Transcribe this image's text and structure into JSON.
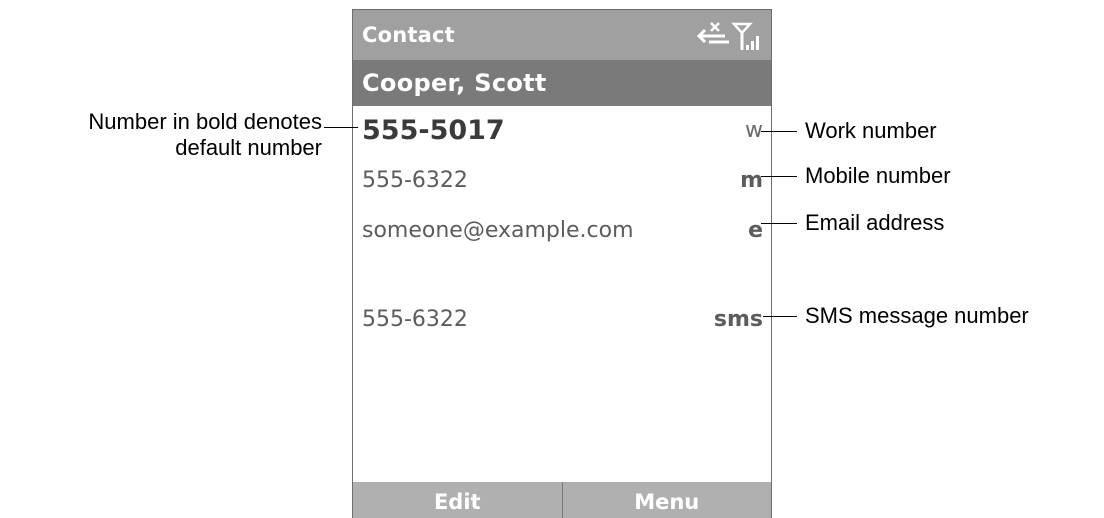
{
  "title_bar": {
    "title": "Contact",
    "icons": [
      "no-data-connection-icon",
      "signal-strength-icon"
    ]
  },
  "contact": {
    "name": "Cooper, Scott"
  },
  "entries": [
    {
      "value": "555-5017",
      "type": "w",
      "default": true
    },
    {
      "value": "555-6322",
      "type": "m",
      "default": false
    },
    {
      "value": "someone@example.com",
      "type": "e",
      "default": false
    },
    {
      "value": "555-6322",
      "type": "sms",
      "default": false
    }
  ],
  "softkeys": {
    "left": "Edit",
    "right": "Menu"
  },
  "annotations": {
    "default_line1": "Number in bold denotes",
    "default_line2": "default number",
    "work": "Work number",
    "mobile": "Mobile number",
    "email": "Email address",
    "sms": "SMS message number"
  },
  "colors": {
    "title_bar": "#a0a0a0",
    "contact_header": "#7a7a7a",
    "softkey_bar": "#b0b0b0"
  }
}
